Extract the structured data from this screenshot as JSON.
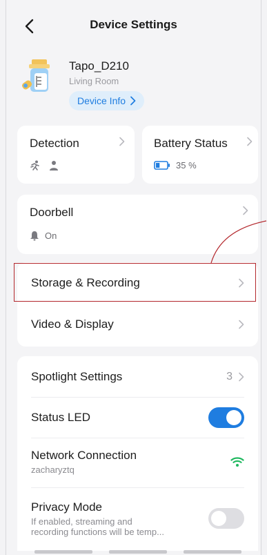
{
  "header": {
    "title": "Device Settings"
  },
  "device": {
    "name": "Tapo_D210",
    "room": "Living Room",
    "info_button": "Device Info"
  },
  "tiles": {
    "detection": {
      "label": "Detection"
    },
    "battery": {
      "label": "Battery Status",
      "value": "35 %",
      "level": 0.35
    }
  },
  "doorbell": {
    "label": "Doorbell",
    "status": "On"
  },
  "menu": {
    "storage_recording": "Storage & Recording",
    "video_display": "Video & Display"
  },
  "settings": {
    "spotlight": {
      "label": "Spotlight Settings",
      "value": "3"
    },
    "status_led": {
      "label": "Status LED",
      "enabled": true
    },
    "network": {
      "label": "Network Connection",
      "ssid": "zacharyztq"
    },
    "privacy": {
      "label": "Privacy Mode",
      "description_line1": "If enabled, streaming and",
      "description_line2": "recording functions will be temp...",
      "enabled": false
    }
  },
  "colors": {
    "accent": "#1f7de0",
    "annotation": "#b3262b",
    "wifi": "#1fb85f"
  }
}
